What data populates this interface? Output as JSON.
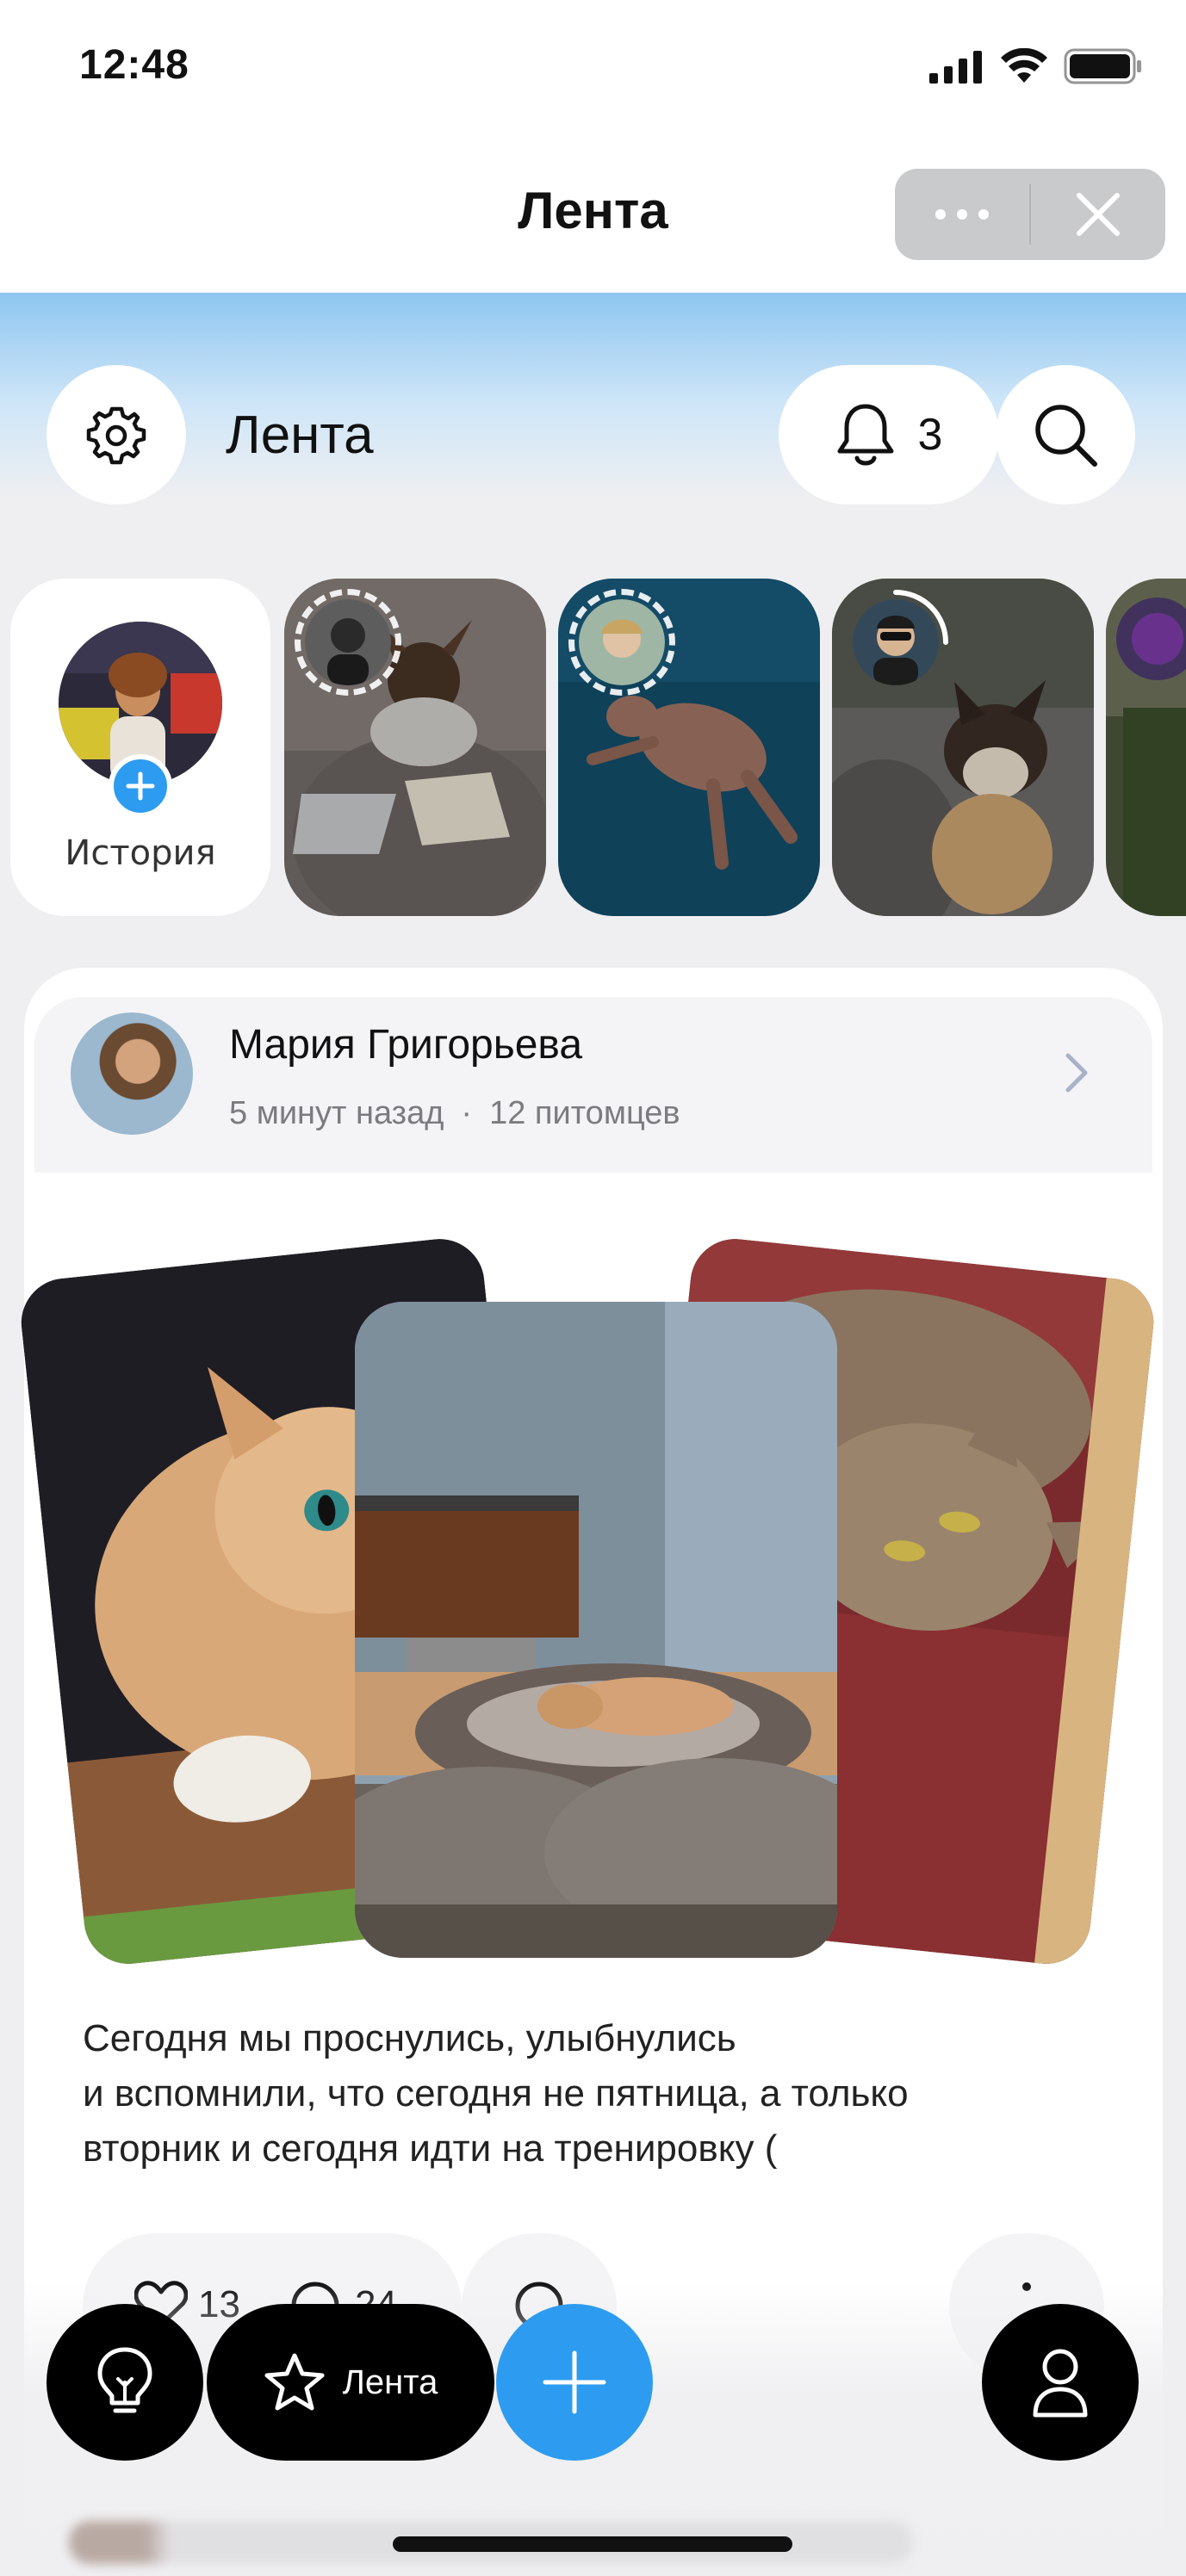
{
  "status_bar": {
    "time": "12:48",
    "icons": [
      "signal-icon",
      "wifi-icon",
      "battery-icon"
    ]
  },
  "nav": {
    "title": "Лента",
    "more_icon": "more-dots-icon",
    "close_icon": "close-icon"
  },
  "feed_header": {
    "title": "Лента",
    "settings_icon": "gear-icon",
    "notifications_count": "3",
    "bell_icon": "bell-icon",
    "search_icon": "search-icon"
  },
  "stories": {
    "add_label": "История",
    "items": [
      {
        "name": "story-chihuahua"
      },
      {
        "name": "story-swimming-pig"
      },
      {
        "name": "story-husky-puppy"
      },
      {
        "name": "story-forest"
      }
    ]
  },
  "post": {
    "author": "Мария Григорьева",
    "time_ago": "5 минут назад",
    "separator": "·",
    "pets": "12 питомцев",
    "text": "Сегодня мы проснулись, улыбнулись\nи вспомнили, что сегодня не пятница, а только\nвторник и сегодня идти на тренировку (",
    "likes": "13",
    "comments": "24"
  },
  "bottom_bar": {
    "ideas_icon": "lightbulb-icon",
    "feed_label": "Лента",
    "feed_icon": "star-icon",
    "add_icon": "plus-icon",
    "profile_icon": "profile-icon"
  },
  "colors": {
    "accent": "#2d9cf0",
    "background": "#efeff1",
    "header_gradient_top": "#8ec6f0"
  }
}
